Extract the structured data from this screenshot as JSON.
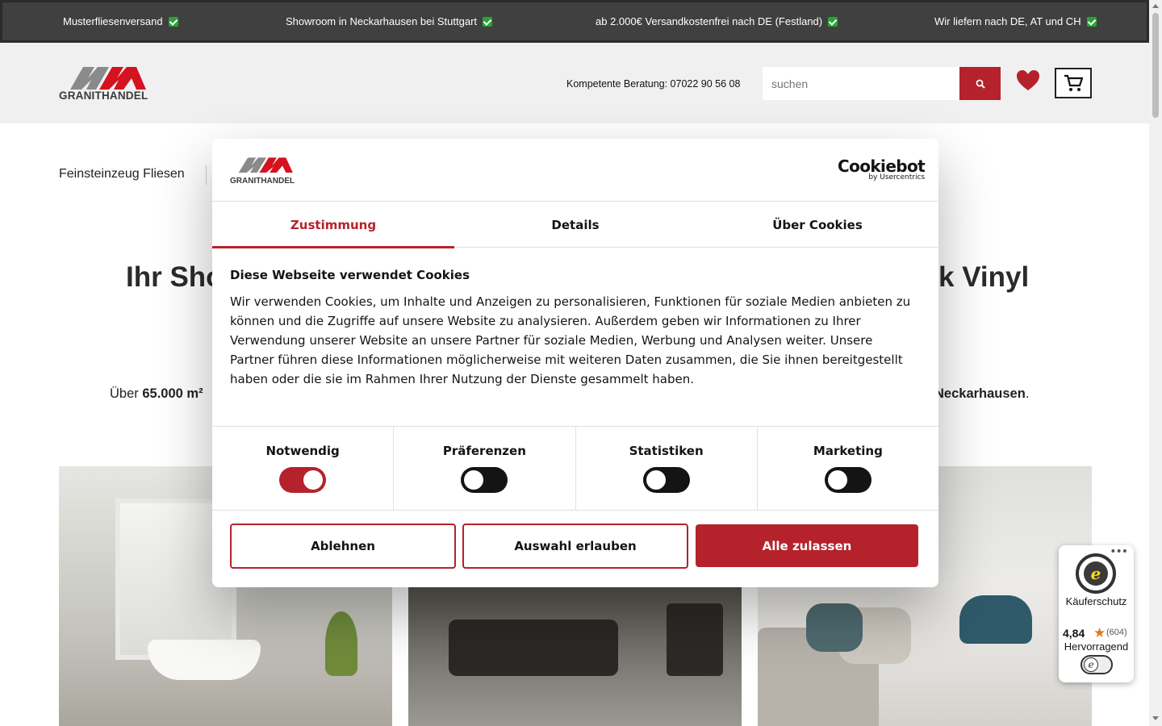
{
  "topbar": {
    "items": [
      {
        "label": "Musterfliesenversand"
      },
      {
        "label": "Showroom in Neckarhausen bei Stuttgart"
      },
      {
        "label": "ab 2.000€ Versandkostenfrei nach DE (Festland)"
      },
      {
        "label": "Wir liefern nach DE, AT und CH"
      }
    ]
  },
  "header": {
    "logo_text": "GRANITHANDEL",
    "phone": "Kompetente Beratung: 07022 90 56 08",
    "search_placeholder": "suchen",
    "icons": [
      "search-icon",
      "heart-icon",
      "cart-icon"
    ],
    "accent_color": "#b5222b"
  },
  "nav": {
    "first_item": "Feinsteinzeug Fliesen"
  },
  "hero": {
    "title_left": "Ihr Sho",
    "title_right": "k Vinyl",
    "subtitle_left_prefix": "Über ",
    "subtitle_left_bold": "65.000 m²",
    "subtitle_right_bold": "Neckarhausen",
    "subtitle_right_suffix": "."
  },
  "cookie_modal": {
    "logo_text": "GRANITHANDEL",
    "brand": "Cookiebot",
    "brand_by": "by Usercentrics",
    "tabs": [
      {
        "label": "Zustimmung",
        "active": true
      },
      {
        "label": "Details",
        "active": false
      },
      {
        "label": "Über Cookies",
        "active": false
      }
    ],
    "title": "Diese Webseite verwendet Cookies",
    "body": "Wir verwenden Cookies, um Inhalte und Anzeigen zu personalisieren, Funktionen für soziale Medien anbieten zu können und die Zugriffe auf unsere Website zu analysieren. Außerdem geben wir Informationen zu Ihrer Verwendung unserer Website an unsere Partner für soziale Medien, Werbung und Analysen weiter. Unsere Partner führen diese Informationen möglicherweise mit weiteren Daten zusammen, die Sie ihnen bereitgestellt haben oder die sie im Rahmen Ihrer Nutzung der Dienste gesammelt haben.",
    "toggles": [
      {
        "label": "Notwendig",
        "on": true
      },
      {
        "label": "Präferenzen",
        "on": false
      },
      {
        "label": "Statistiken",
        "on": false
      },
      {
        "label": "Marketing",
        "on": false
      }
    ],
    "buttons": {
      "decline": "Ablehnen",
      "allow_selection": "Auswahl erlauben",
      "allow_all": "Alle zulassen"
    }
  },
  "trusted_shops": {
    "label": "Käuferschutz",
    "rating": "4,84",
    "count": "(604)",
    "verdict": "Hervorragend",
    "seal_letter": "e"
  }
}
